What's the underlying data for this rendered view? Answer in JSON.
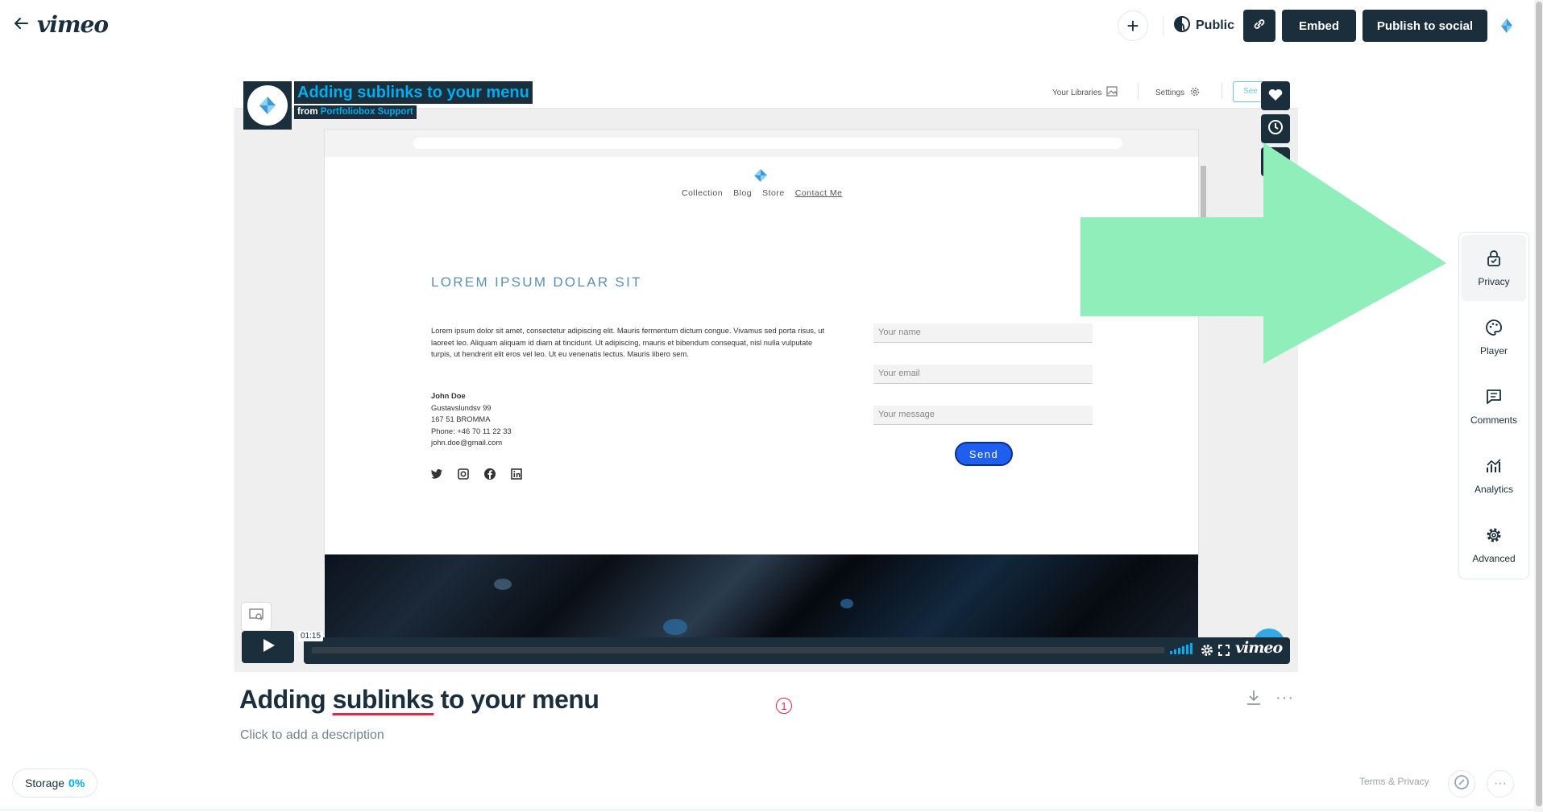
{
  "topbar": {
    "logo": "vimeo",
    "visibility_label": "Public",
    "embed_label": "Embed",
    "publish_label": "Publish to social"
  },
  "player": {
    "overlay_title": "Adding sublinks to your menu",
    "byline_prefix": "from",
    "byline_author": "Portfoliobox Support",
    "time": "01:15",
    "brand": "vimeo",
    "app_header": {
      "libraries": "Your Libraries",
      "settings": "Settings",
      "see": "See"
    },
    "site": {
      "nav": [
        "Collection",
        "Blog",
        "Store",
        "Contact Me"
      ],
      "heading": "LOREM IPSUM DOLAR SIT",
      "body": "Lorem ipsum dolor sit amet, consectetur adipiscing elit. Mauris fermentum dictum congue. Vivamus sed porta risus, ut laoreet leo. Aliquam aliquam id diam at tincidunt. Ut adipiscing, mauris et bibendum consequat, nisl nulla vulputate turpis, ut hendrerit elit eros vel leo. Ut eu venenatis lectus. Mauris libero sem.",
      "address": {
        "name": "John Doe",
        "street": "Gustavslundsv 99",
        "city": "167 51 BROMMA",
        "phone": "Phone: +46 70 11 22 33",
        "email": "john.doe@gmail.com"
      },
      "form": {
        "name_placeholder": "Your name",
        "email_placeholder": "Your email",
        "message_placeholder": "Your message",
        "send_label": "Send"
      }
    }
  },
  "side_panel": {
    "items": [
      "Privacy",
      "Player",
      "Comments",
      "Analytics",
      "Advanced"
    ]
  },
  "video": {
    "title_before": "Adding ",
    "title_underlined": "sublinks",
    "title_after": " to your menu",
    "badge": "1",
    "description_placeholder": "Click to add a description"
  },
  "footer": {
    "storage_label": "Storage",
    "storage_value": "0%",
    "terms": "Terms & Privacy"
  },
  "colors": {
    "navy": "#1a2e3b",
    "accent_blue": "#00adef",
    "arrow_green": "#90eebb",
    "error_red": "#e0284a"
  }
}
